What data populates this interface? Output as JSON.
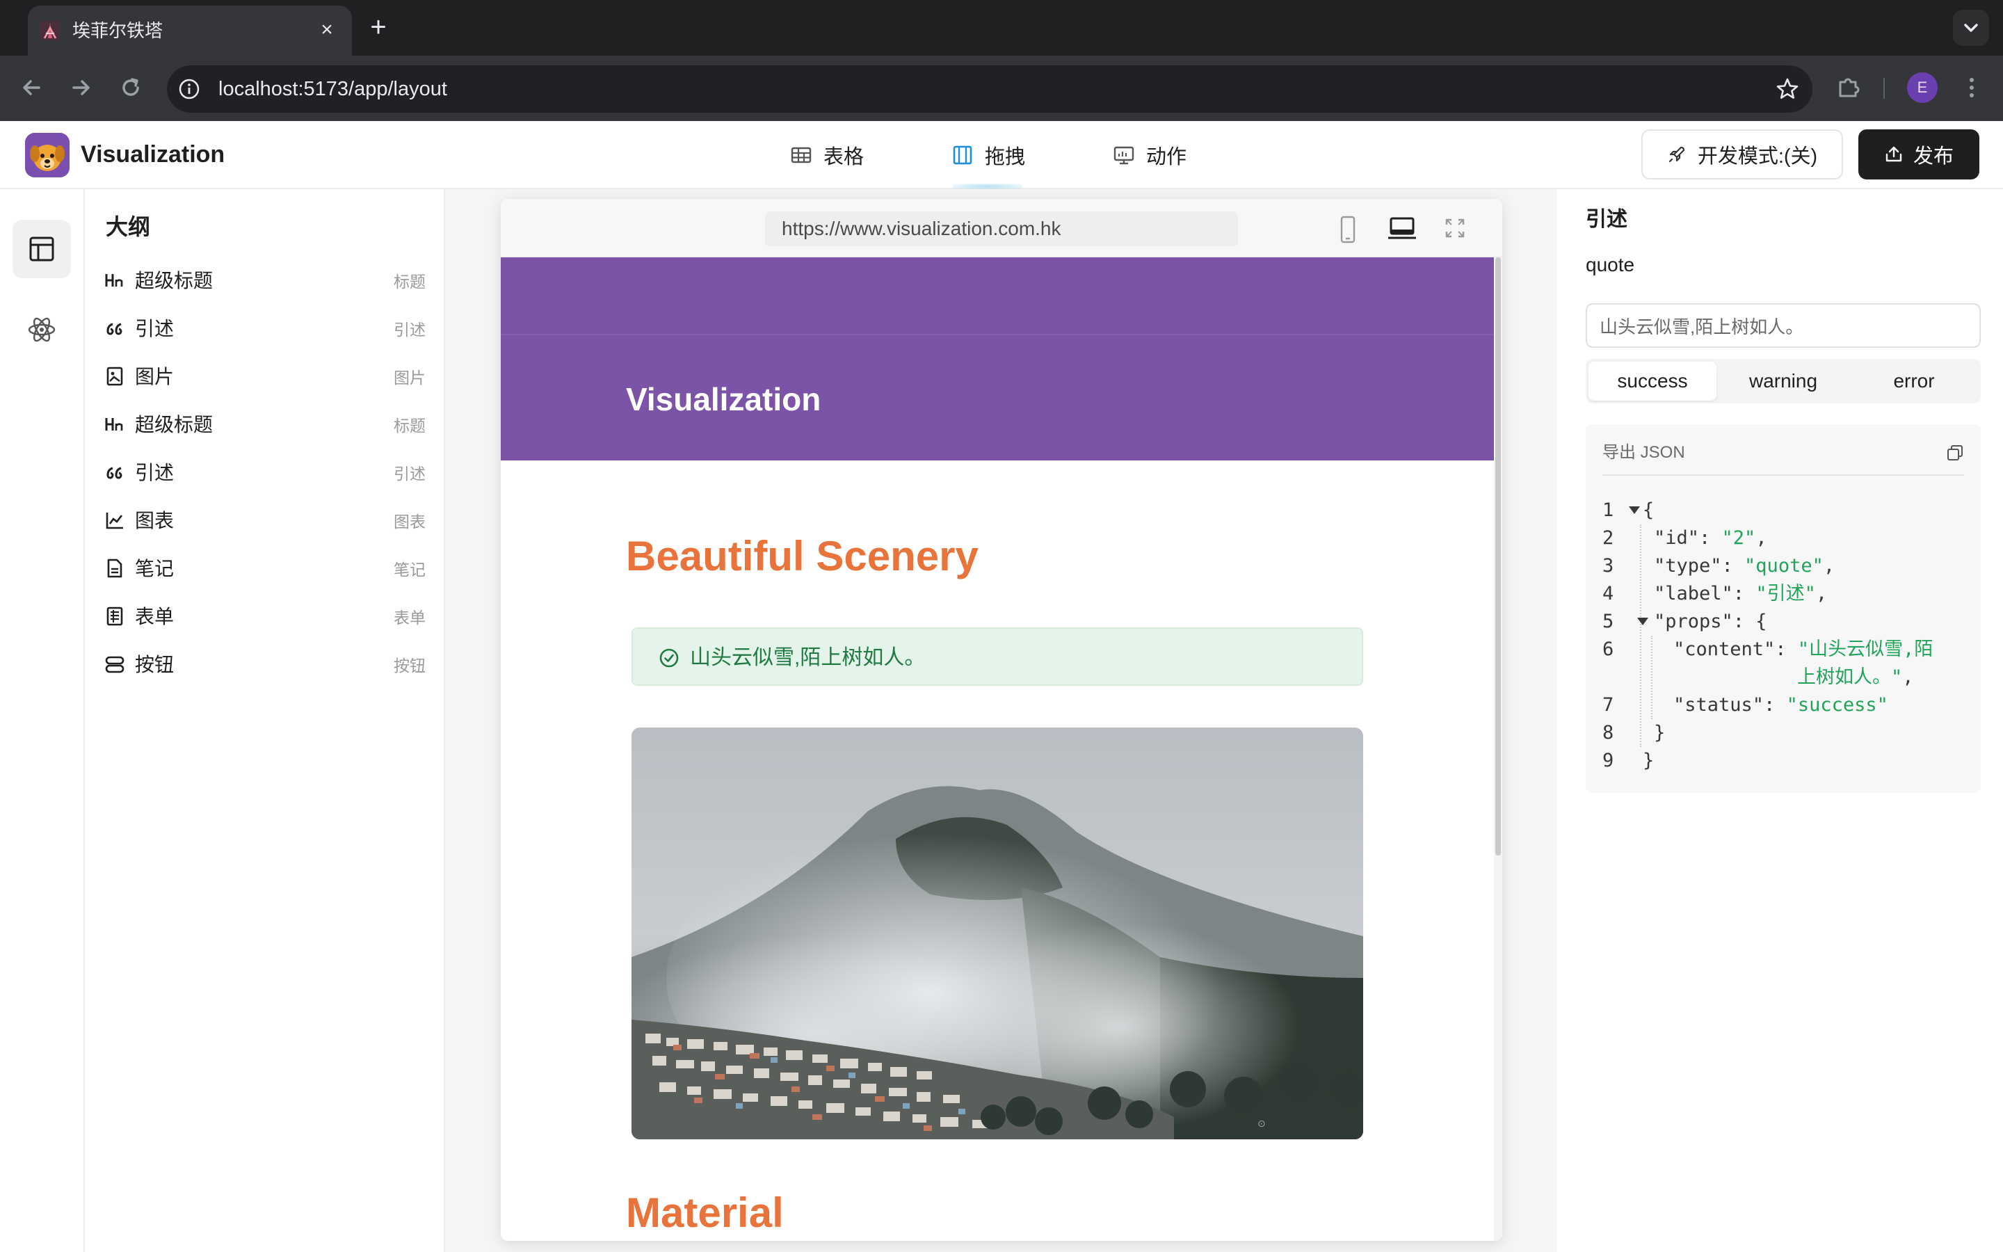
{
  "browser": {
    "tab_title": "埃菲尔铁塔",
    "tab_close": "×",
    "new_tab": "+",
    "url": "localhost:5173/app/layout",
    "profile_initial": "E"
  },
  "app": {
    "title": "Visualization",
    "nav": [
      {
        "label": "表格",
        "icon": "table-icon"
      },
      {
        "label": "拖拽",
        "icon": "drag-icon",
        "active": true
      },
      {
        "label": "动作",
        "icon": "action-icon"
      }
    ],
    "dev_mode_label": "开发模式:(关)",
    "publish_label": "发布"
  },
  "outline": {
    "title": "大纲",
    "items": [
      {
        "icon_text": "Hn",
        "label": "超级标题",
        "tag": "标题"
      },
      {
        "icon_text": "❝",
        "label": "引述",
        "tag": "引述"
      },
      {
        "icon_text": "img",
        "label": "图片",
        "tag": "图片"
      },
      {
        "icon_text": "Hn",
        "label": "超级标题",
        "tag": "标题"
      },
      {
        "icon_text": "❝",
        "label": "引述",
        "tag": "引述"
      },
      {
        "icon_text": "chart",
        "label": "图表",
        "tag": "图表"
      },
      {
        "icon_text": "note",
        "label": "笔记",
        "tag": "笔记"
      },
      {
        "icon_text": "form",
        "label": "表单",
        "tag": "表单"
      },
      {
        "icon_text": "btn",
        "label": "按钮",
        "tag": "按钮"
      }
    ]
  },
  "preview": {
    "url": "https://www.visualization.com.hk",
    "hero_title": "Visualization",
    "hero_color": "#7b54a8",
    "section_title": "Beautiful Scenery",
    "accent_color": "#e8743b",
    "quote_text": "山头云似雪,陌上树如人。",
    "section_title_2": "Material"
  },
  "props": {
    "title": "引述",
    "type": "quote",
    "input_value": "山头云似雪,陌上树如人。",
    "status_options": [
      "success",
      "warning",
      "error"
    ],
    "selected_status": "success",
    "json_title": "导出 JSON",
    "json": {
      "l1": "{",
      "l2a": "\"id\": ",
      "l2b": "\"2\"",
      "l2c": ",",
      "l3a": "\"type\": ",
      "l3b": "\"quote\"",
      "l3c": ",",
      "l4a": "\"label\": ",
      "l4b": "\"引述\"",
      "l4c": ",",
      "l5": "\"props\": {",
      "l6a": "\"content\": ",
      "l6b": "\"山头云似雪,陌",
      "l6c": "上树如人。\"",
      "l6d": ",",
      "l7a": "\"status\": ",
      "l7b": "\"success\"",
      "l8": "}",
      "l9": "}",
      "line_numbers": [
        "1",
        "2",
        "3",
        "4",
        "5",
        "6",
        "7",
        "8",
        "9"
      ]
    }
  }
}
